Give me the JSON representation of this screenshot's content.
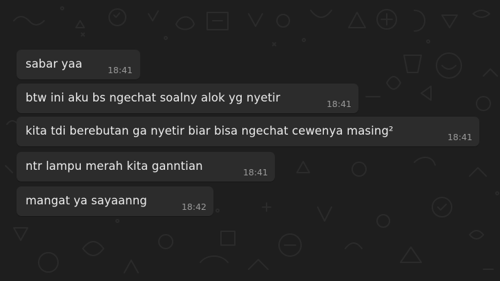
{
  "chat": {
    "messages": [
      {
        "text": "sabar yaa",
        "time": "18:41"
      },
      {
        "text": "btw ini aku bs ngechat soalny alok yg nyetir",
        "time": "18:41"
      },
      {
        "text": "kita tdi berebutan ga nyetir biar bisa ngechat cewenya masing²",
        "time": "18:41"
      },
      {
        "text": "ntr lampu merah kita ganntian",
        "time": "18:41"
      },
      {
        "text": "mangat ya sayaanng",
        "time": "18:42"
      }
    ]
  },
  "colors": {
    "background": "#1e1e1e",
    "bubble": "#2c2c2c",
    "message_text": "#ececec",
    "timestamp": "#9a9a9a",
    "doodle": "#2a2a2a"
  }
}
